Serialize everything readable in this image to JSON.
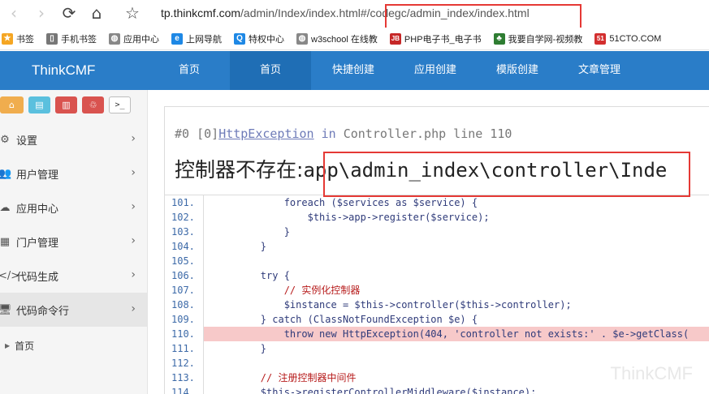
{
  "browser": {
    "url_host": "tp.thinkcmf.com",
    "url_path": "/admin/Index/index.html#/codegc/admin_index/index.html"
  },
  "bookmarks": [
    {
      "label": "书签",
      "icon": "star-icon",
      "color": "#f5a623"
    },
    {
      "label": "手机书签",
      "icon": "phone-icon",
      "color": "#777777"
    },
    {
      "label": "应用中心",
      "icon": "globe-icon",
      "color": "#888888"
    },
    {
      "label": "上网导航",
      "icon": "ie-icon",
      "color": "#1e88e5"
    },
    {
      "label": "特权中心",
      "icon": "q-icon",
      "color": "#1e88e5"
    },
    {
      "label": "w3school 在线教",
      "icon": "globe-icon",
      "color": "#888888"
    },
    {
      "label": "PHP电子书_电子书",
      "icon": "jb-icon",
      "color": "#c62828"
    },
    {
      "label": "我要自学网-视频教",
      "icon": "leaf-icon",
      "color": "#2e7d32"
    },
    {
      "label": "51CTO.COM",
      "icon": "51-icon",
      "color": "#d32f2f"
    }
  ],
  "app": {
    "brand": "ThinkCMF",
    "nav": [
      "首页",
      "首页",
      "快捷创建",
      "应用创建",
      "模版创建",
      "文章管理"
    ]
  },
  "sidebar": {
    "menu": [
      {
        "label": "设置",
        "icon": "gears-icon"
      },
      {
        "label": "用户管理",
        "icon": "users-icon"
      },
      {
        "label": "应用中心",
        "icon": "cloud-icon"
      },
      {
        "label": "门户管理",
        "icon": "th-icon"
      },
      {
        "label": "代码生成",
        "icon": "code-icon"
      },
      {
        "label": "代码命令行",
        "icon": "desktop-icon"
      }
    ],
    "sub_item": "首页"
  },
  "exception": {
    "prefix": "#0 [0]",
    "class_name": "HttpException",
    "in_word": "in",
    "location": "Controller.php line 110",
    "message_cn": "控制器不存在:",
    "message_path": "app\\admin_index\\controller\\Inde"
  },
  "code_lines": [
    {
      "no": "101.",
      "text": "            foreach ($services as $service) {"
    },
    {
      "no": "102.",
      "text": "                $this->app->register($service);"
    },
    {
      "no": "103.",
      "text": "            }"
    },
    {
      "no": "104.",
      "text": "        }"
    },
    {
      "no": "105.",
      "text": ""
    },
    {
      "no": "106.",
      "text": "        try {"
    },
    {
      "no": "107.",
      "text": "            // 实例化控制器"
    },
    {
      "no": "108.",
      "text": "            $instance = $this->controller($this->controller);"
    },
    {
      "no": "109.",
      "text": "        } catch (ClassNotFoundException $e) {"
    },
    {
      "no": "110.",
      "text": "            throw new HttpException(404, 'controller not exists:' . $e->getClass("
    },
    {
      "no": "111.",
      "text": "        }"
    },
    {
      "no": "112.",
      "text": ""
    },
    {
      "no": "113.",
      "text": "        // 注册控制器中间件"
    },
    {
      "no": "114.",
      "text": "        $this->registerControllerMiddleware($instance);"
    }
  ],
  "watermark": "ThinkCMF",
  "colors": {
    "header": "#2a7dc8",
    "header_active": "#1f6eb5",
    "highlight": "#f7c9c9"
  }
}
